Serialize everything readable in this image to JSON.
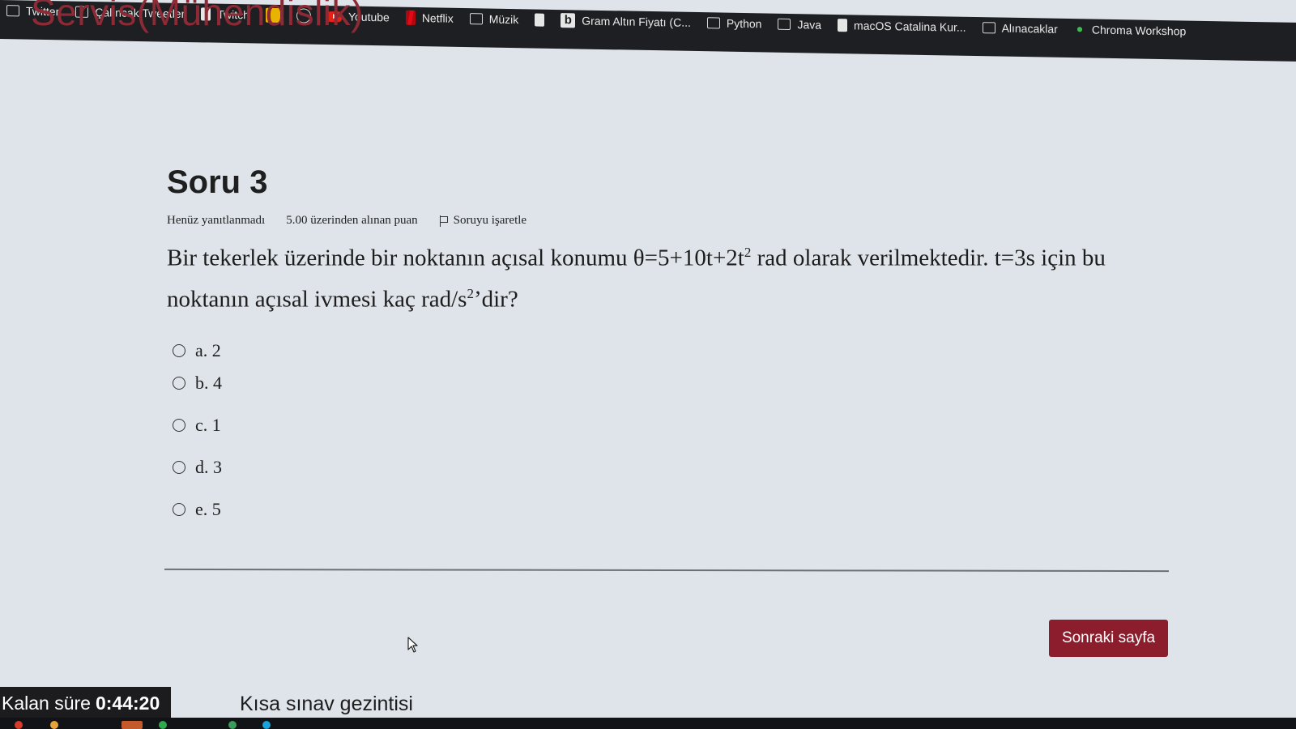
{
  "bookmarks": [
    {
      "label": "Twitter",
      "icon": "folder-icon"
    },
    {
      "label": "Çalıncak Tweetler",
      "icon": "folder-icon"
    },
    {
      "label": "Twitch",
      "icon": "document-icon"
    },
    {
      "label": "",
      "icon": "norton-icon"
    },
    {
      "label": "",
      "icon": "gauge-icon"
    },
    {
      "label": "Youtube",
      "icon": "youtube-icon"
    },
    {
      "label": "Netflix",
      "icon": "netflix-icon"
    },
    {
      "label": "Müzik",
      "icon": "folder-icon"
    },
    {
      "label": "",
      "icon": "document-icon"
    },
    {
      "label": "Gram Altın Fiyatı (C...",
      "icon": "bloomberg-icon"
    },
    {
      "label": "Python",
      "icon": "folder-icon"
    },
    {
      "label": "Java",
      "icon": "folder-icon"
    },
    {
      "label": "macOS Catalina Kur...",
      "icon": "document-icon"
    },
    {
      "label": "Alınacaklar",
      "icon": "folder-icon"
    },
    {
      "label": "Chroma Workshop",
      "icon": "chroma-icon"
    }
  ],
  "page": {
    "heading": "Servis(Mühendislik)"
  },
  "question": {
    "title": "Soru 3",
    "status": "Henüz yanıtlanmadı",
    "points": "5.00 üzerinden alınan puan",
    "flag_label": "Soruyu işaretle",
    "text_part1": "Bir tekerlek üzerinde bir noktanın açısal konumu θ=5+10t+2t",
    "text_sup1": "2",
    "text_part2": " rad olarak verilmektedir. t=3s için bu noktanın açısal ivmesi kaç rad/s",
    "text_sup2": "2",
    "text_part3": "’dir?",
    "answers": [
      {
        "label": "a. 2"
      },
      {
        "label": "b. 4"
      },
      {
        "label": "c. 1"
      },
      {
        "label": "d. 3"
      },
      {
        "label": "e. 5"
      }
    ]
  },
  "navigation": {
    "next_button": "Sonraki sayfa",
    "quiz_nav": "Kısa sınav gezintisi"
  },
  "timer": {
    "label": "Kalan süre",
    "value": "0:44:20"
  },
  "colors": {
    "accent": "#8c1d2c",
    "heading": "#8c2a36",
    "background": "#dfe4ea"
  }
}
